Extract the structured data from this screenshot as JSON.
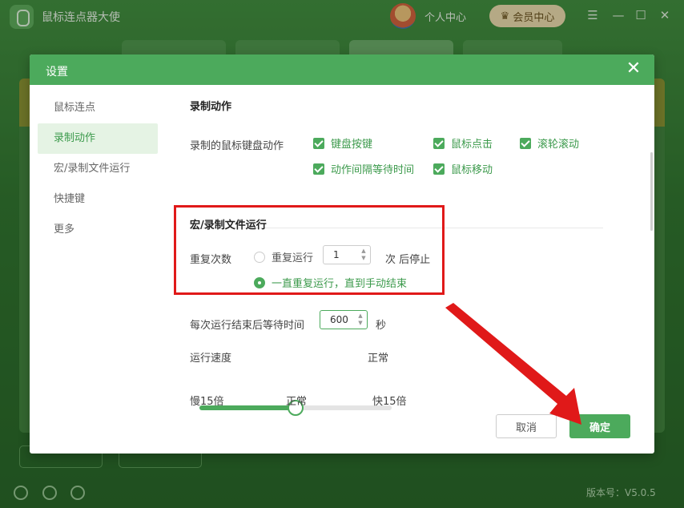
{
  "app": {
    "title": "鼠标连点器大使",
    "personal_center": "个人中心",
    "vip_center": "会员中心",
    "version": "版本号：V5.0.5"
  },
  "dialog": {
    "title": "设置",
    "nav": [
      {
        "label": "鼠标连点"
      },
      {
        "label": "录制动作"
      },
      {
        "label": "宏/录制文件运行"
      },
      {
        "label": "快捷键"
      },
      {
        "label": "更多"
      }
    ],
    "record": {
      "title": "录制动作",
      "label": "录制的鼠标键盘动作",
      "options": [
        "键盘按键",
        "鼠标点击",
        "滚轮滚动",
        "动作间隔等待时间",
        "鼠标移动"
      ]
    },
    "macro": {
      "title": "宏/录制文件运行",
      "repeat_label": "重复次数",
      "repeat_run": "重复运行",
      "repeat_value": "1",
      "stop_after": "次 后停止",
      "forever": "一直重复运行，直到手动结束",
      "wait_label": "每次运行结束后等待时间",
      "wait_value": "600",
      "wait_unit": "秒"
    },
    "speed": {
      "label": "运行速度",
      "current": "正常",
      "level": 0.5,
      "min_label": "慢15倍",
      "mid_label": "正常",
      "max_label": "快15倍"
    },
    "buttons": {
      "cancel": "取消",
      "ok": "确定"
    }
  },
  "colors": {
    "accent": "#4caa5c",
    "annotation": "#e01919"
  }
}
